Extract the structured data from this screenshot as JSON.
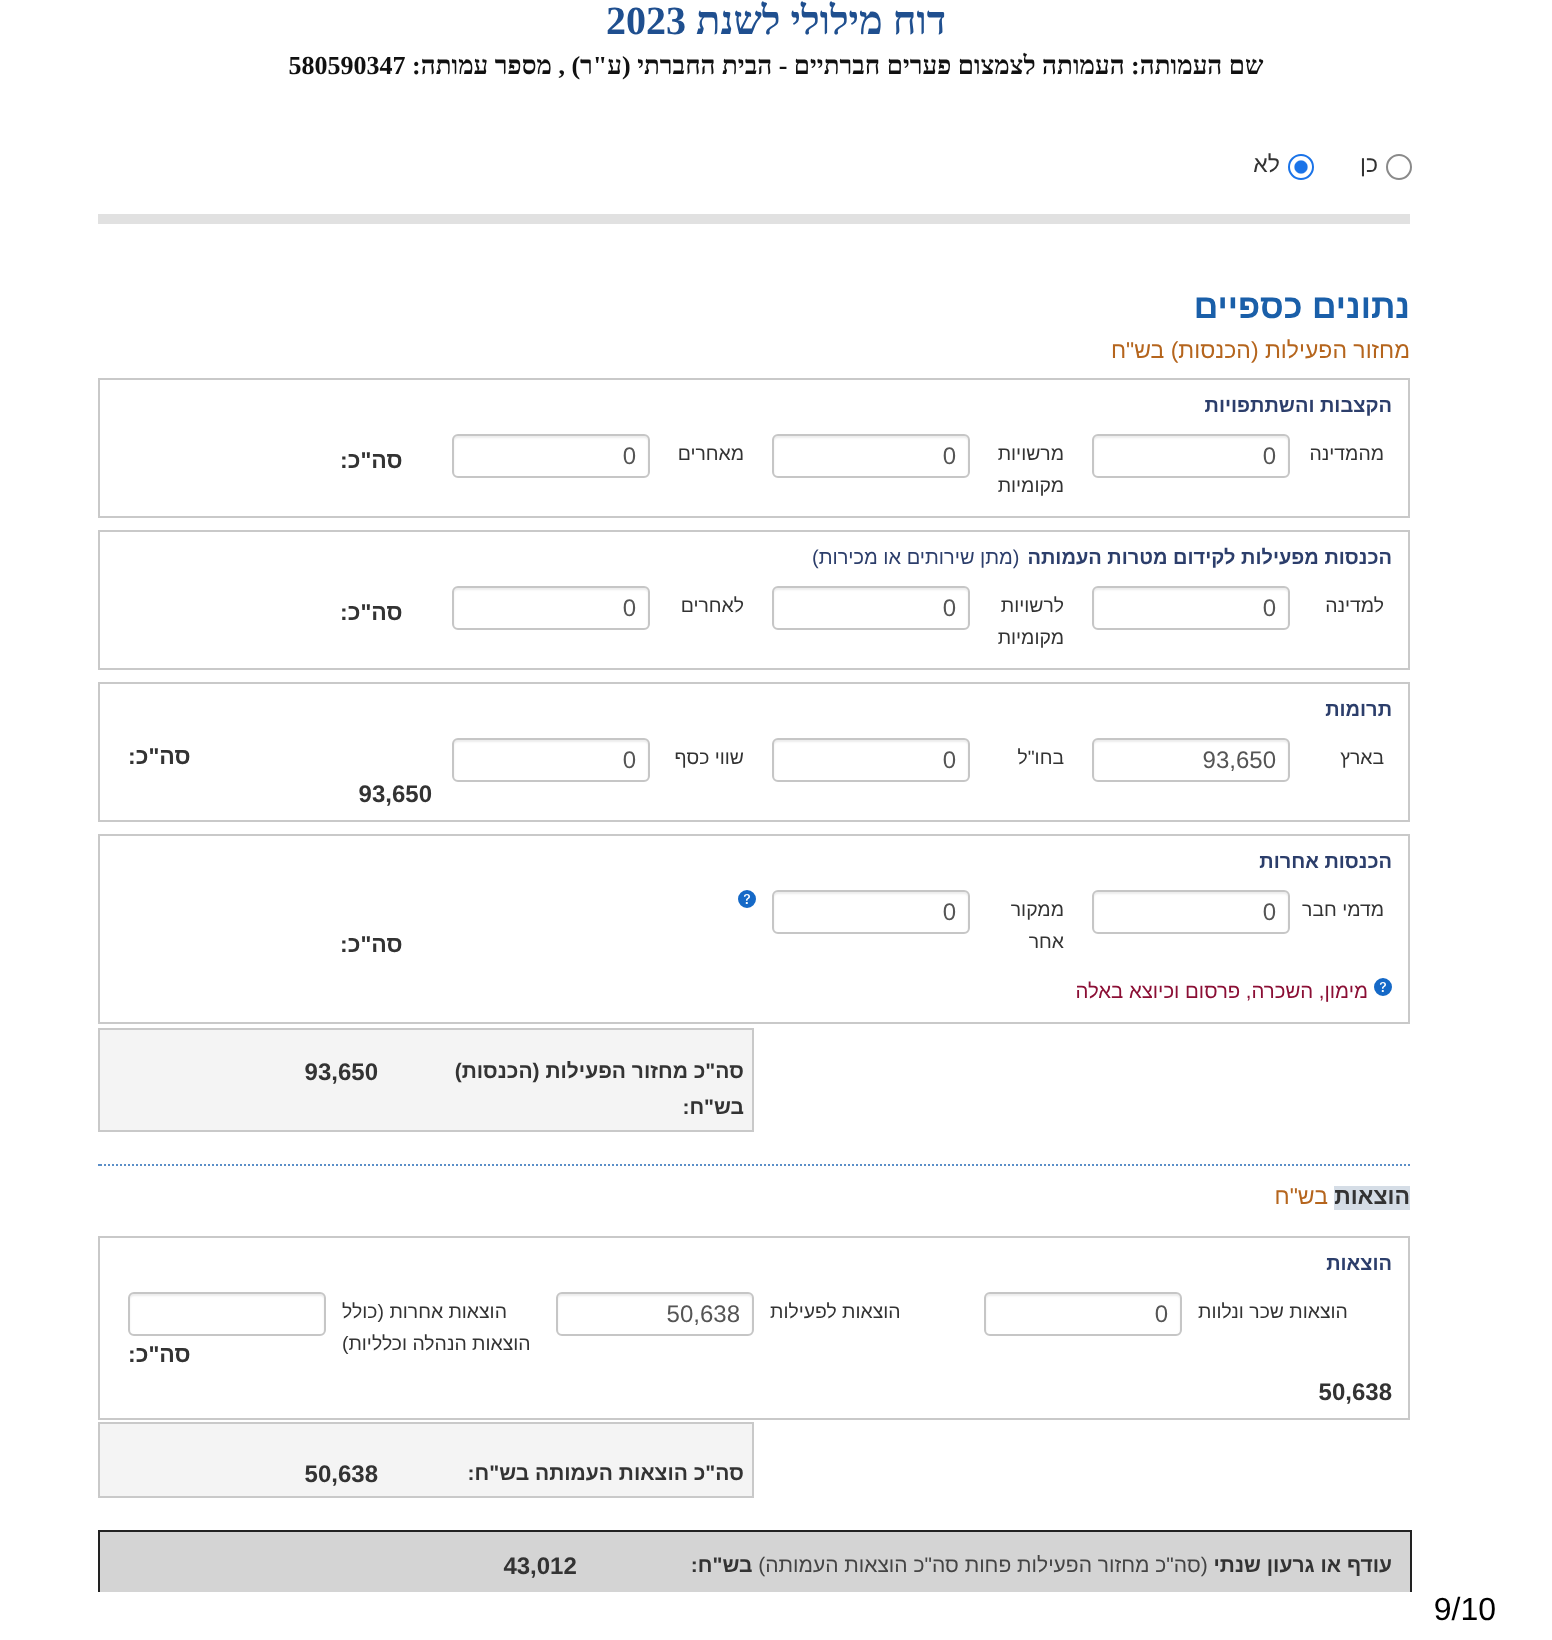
{
  "report_title": "דוח מילולי לשנת 2023",
  "org_line": "שם העמותה: העמותה לצמצום פערים חברתיים - הבית החברתי (ע\"ר) , מספר עמותה: 580590347",
  "yes_no_options": [
    {
      "label": "כן",
      "selected": false
    },
    {
      "label": "לא",
      "selected": true
    }
  ],
  "financial_data": {
    "heading": "נתונים כספיים",
    "income": {
      "heading": "מחזור הפעילות (הכנסות) בש\"ח",
      "sections": [
        {
          "title": "הקצבות והשתתפויות",
          "fields": [
            {
              "label": "מהמדינה",
              "value": "0"
            },
            {
              "label": "מרשויות מקומיות",
              "value": "0"
            },
            {
              "label": "מאחרים",
              "value": "0"
            }
          ],
          "total": {
            "label": "סה\"כ:"
          }
        },
        {
          "title": "הכנסות מפעילות לקידום מטרות העמותה",
          "title_note": "(מתן שירותים או מכירות)",
          "fields": [
            {
              "label": "למדינה",
              "value": "0"
            },
            {
              "label": "לרשויות מקומיות",
              "value": "0"
            },
            {
              "label": "לאחרים",
              "value": "0"
            }
          ],
          "total": {
            "label": "סה\"כ:"
          }
        },
        {
          "title": "תרומות",
          "fields": [
            {
              "label": "בארץ",
              "value": "93,650"
            },
            {
              "label": "בחו\"ל",
              "value": "0"
            },
            {
              "label": "שווי כסף",
              "value": "0"
            }
          ],
          "total": {
            "label": "סה\"כ:",
            "value": "93,650"
          }
        },
        {
          "title": "הכנסות אחרות",
          "fields": [
            {
              "label": "מדמי חבר",
              "value": "0",
              "help": false
            },
            {
              "label": "ממקור אחר",
              "value": "0",
              "help": true
            }
          ],
          "total": {
            "label": "סה\"כ:"
          },
          "note": {
            "text": "מימון, השכרה, פרסום וכיוצא באלה",
            "help": true
          }
        }
      ],
      "summary": {
        "label": "סה\"כ מחזור הפעילות (הכנסות) בש\"ח:",
        "value": "93,650"
      }
    },
    "expenses": {
      "heading": "**הוצאות** בש\"ח",
      "sections": [
        {
          "title": "הוצאות",
          "fields": [
            {
              "label": "הוצאות שכר ונלוות",
              "value": "0"
            },
            {
              "label": "הוצאות לפעילות",
              "value": "50,638"
            },
            {
              "label": "הוצאות אחרות (כולל הוצאות הנהלה וכלליות)"
            }
          ],
          "total": {
            "label": "סה\"כ:",
            "value": "50,638"
          }
        }
      ],
      "summary": {
        "label": "סה\"כ הוצאות העמותה בש\"ח:",
        "value": "50,638"
      }
    },
    "balance": {
      "label": "**עודף או גרעון שנתי** (סה\"כ מחזור הפעילות פחות סה\"כ הוצאות העמותה) **בש\"ח:**",
      "value": "43,012"
    }
  },
  "page_number": "9/10"
}
